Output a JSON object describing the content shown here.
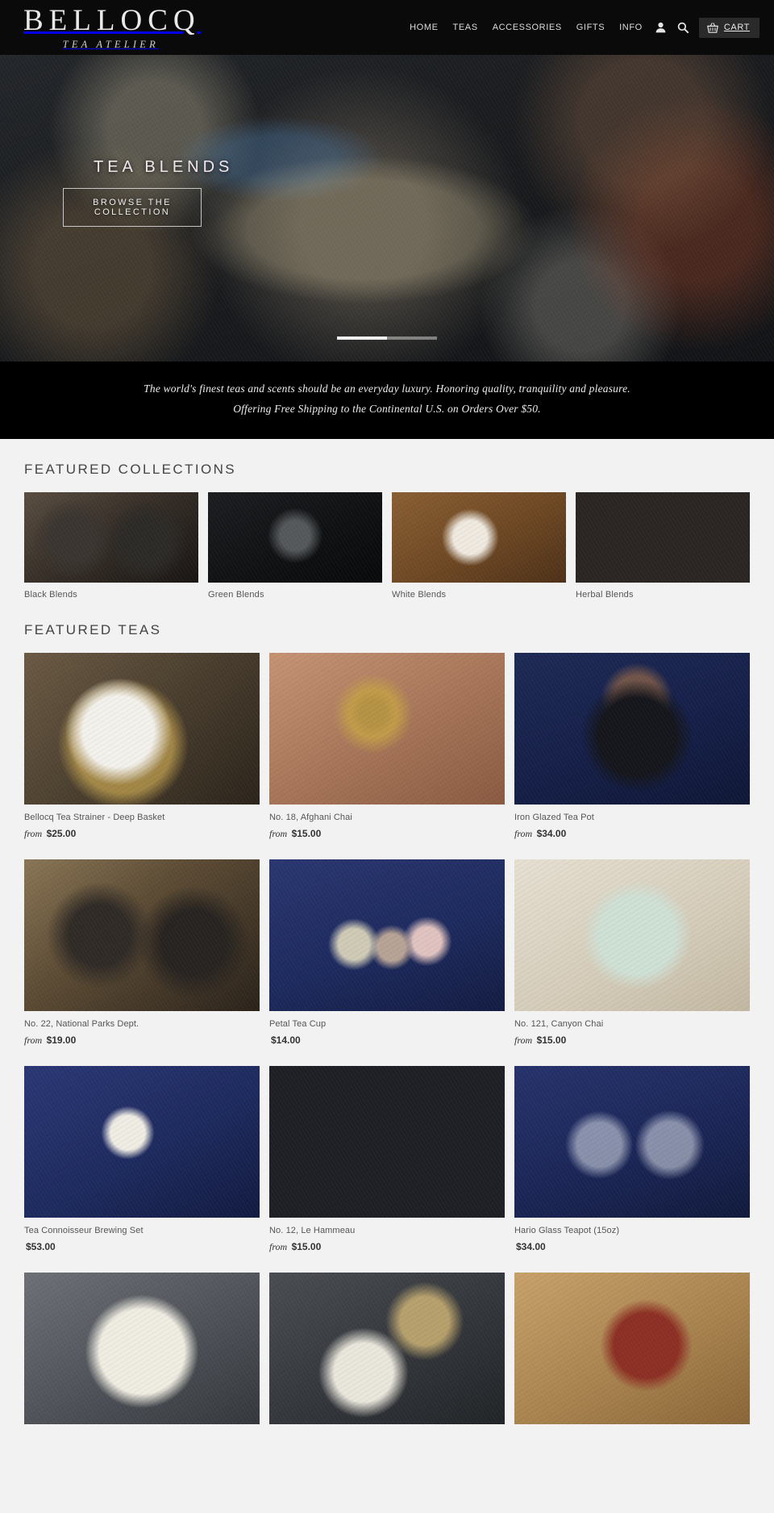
{
  "header": {
    "logo_name": "BELLOCQ",
    "logo_sub": "TEA ATELIER",
    "nav": [
      {
        "label": "HOME"
      },
      {
        "label": "TEAS"
      },
      {
        "label": "ACCESSORIES"
      },
      {
        "label": "GIFTS"
      },
      {
        "label": "INFO"
      }
    ],
    "account_icon": "user-icon",
    "search_icon": "search-icon",
    "cart_icon": "basket-icon",
    "cart_label": "CART"
  },
  "hero": {
    "title": "TEA BLENDS",
    "button_label": "BROWSE THE COLLECTION",
    "slides": 3,
    "active_slide": 1
  },
  "tagline": {
    "line1": "The world's finest teas and scents should be an everyday luxury. Honoring quality, tranquility and pleasure.",
    "line2": "Offering Free Shipping to the Continental U.S. on Orders Over $50."
  },
  "featured_collections": {
    "title": "FEATURED COLLECTIONS",
    "items": [
      {
        "label": "Black Blends",
        "image_class": "img-black-blends"
      },
      {
        "label": "Green Blends",
        "image_class": "img-green-blends"
      },
      {
        "label": "White Blends",
        "image_class": "img-white-blends"
      },
      {
        "label": "Herbal Blends",
        "image_class": "img-herbal-blends"
      }
    ]
  },
  "featured_teas": {
    "title": "FEATURED TEAS",
    "items": [
      {
        "title": "Bellocq Tea Strainer - Deep Basket",
        "price_prefix": "from",
        "price": "$25.00",
        "image_class": "img-strainer"
      },
      {
        "title": "No. 18, Afghani Chai",
        "price_prefix": "from",
        "price": "$15.00",
        "image_class": "img-chai18"
      },
      {
        "title": "Iron Glazed Tea Pot",
        "price_prefix": "from",
        "price": "$34.00",
        "image_class": "img-ironpot"
      },
      {
        "title": "No. 22, National Parks Dept.",
        "price_prefix": "from",
        "price": "$19.00",
        "image_class": "img-parks22"
      },
      {
        "title": "Petal Tea Cup",
        "price_prefix": "",
        "price": "$14.00",
        "image_class": "img-petalcup"
      },
      {
        "title": "No. 121, Canyon Chai",
        "price_prefix": "from",
        "price": "$15.00",
        "image_class": "img-canyon121"
      },
      {
        "title": "Tea Connoisseur Brewing Set",
        "price_prefix": "",
        "price": "$53.00",
        "image_class": "img-brewset"
      },
      {
        "title": "No. 12, Le Hammeau",
        "price_prefix": "from",
        "price": "$15.00",
        "image_class": "img-hammeau12"
      },
      {
        "title": "Hario Glass Teapot (15oz)",
        "price_prefix": "",
        "price": "$34.00",
        "image_class": "img-hario"
      },
      {
        "title": "",
        "price_prefix": "",
        "price": "",
        "image_class": "img-spoonplate"
      },
      {
        "title": "",
        "price_prefix": "",
        "price": "",
        "image_class": "img-matcha"
      },
      {
        "title": "",
        "price_prefix": "",
        "price": "",
        "image_class": "img-redbowl"
      }
    ]
  },
  "colors": {
    "header_bg": "#0a0a0a",
    "page_bg": "#f2f2f2",
    "text": "#555555",
    "cart_bg": "#2a2a2a"
  }
}
